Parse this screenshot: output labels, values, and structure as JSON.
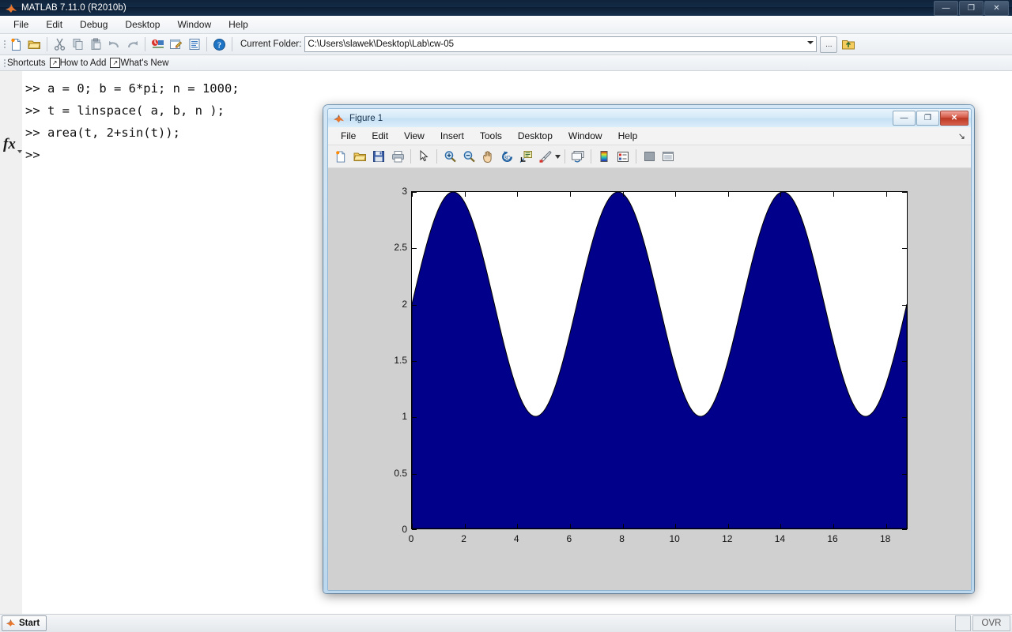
{
  "app": {
    "title": "MATLAB  7.11.0 (R2010b)",
    "icon": "matlab-logo-icon",
    "window_buttons": [
      {
        "name": "minimize",
        "glyph": "—"
      },
      {
        "name": "restore",
        "glyph": "❐"
      },
      {
        "name": "close",
        "glyph": "✕"
      }
    ]
  },
  "menubar": {
    "items": [
      "File",
      "Edit",
      "Debug",
      "Desktop",
      "Window",
      "Help"
    ]
  },
  "toolbar": {
    "icons": [
      "new-file-icon",
      "open-folder-icon",
      "cut-icon",
      "copy-icon",
      "paste-icon",
      "undo-icon",
      "redo-icon",
      "simulink-icon",
      "guide-icon",
      "profiler-icon",
      "help-icon"
    ],
    "current_folder_label": "Current Folder:",
    "current_folder_value": "C:\\Users\\slawek\\Desktop\\Lab\\cw-05",
    "browse_button_label": "...",
    "up_folder_icon": "up-folder-icon"
  },
  "shortcuts_bar": {
    "items": [
      "Shortcuts",
      "How to Add",
      "What's New"
    ],
    "icon": "shortcut-arrow-icon"
  },
  "command_window": {
    "prompt_icon": "fx-icon",
    "lines": [
      ">> a = 0; b = 6*pi; n = 1000;",
      ">> t = linspace( a, b, n );",
      ">> area(t, 2+sin(t));",
      ">> "
    ]
  },
  "statusbar": {
    "start_label": "Start",
    "start_icon": "matlab-logo-icon",
    "overwrite_label": "OVR"
  },
  "figure": {
    "title": "Figure 1",
    "icon": "matlab-logo-icon",
    "window_buttons": [
      {
        "name": "minimize",
        "glyph": "—"
      },
      {
        "name": "maximize",
        "glyph": "❐"
      },
      {
        "name": "close",
        "glyph": "✕"
      }
    ],
    "menubar": [
      "File",
      "Edit",
      "View",
      "Insert",
      "Tools",
      "Desktop",
      "Window",
      "Help"
    ],
    "menu_overflow_icon": "overflow-arrow-icon",
    "toolbar_icons": [
      "new-figure-icon",
      "open-file-icon",
      "save-figure-icon",
      "print-figure-icon",
      "pointer-icon",
      "zoom-in-icon",
      "zoom-out-icon",
      "pan-icon",
      "rotate-3d-icon",
      "data-cursor-icon",
      "brush-icon",
      "brush-dropdown-icon",
      "link-plot-icon",
      "colorbar-icon",
      "legend-icon",
      "hide-plot-tools-icon",
      "show-plot-tools-icon"
    ]
  },
  "chart_data": {
    "type": "area",
    "title": "",
    "xlabel": "",
    "ylabel": "",
    "expression": "area(t, 2+sin(t))",
    "xlim": [
      0,
      18.8495559
    ],
    "ylim": [
      0,
      3
    ],
    "xticks": [
      0,
      2,
      4,
      6,
      8,
      10,
      12,
      14,
      16,
      18
    ],
    "yticks": [
      0,
      0.5,
      1,
      1.5,
      2,
      2.5,
      3
    ],
    "xtick_labels": [
      "0",
      "2",
      "4",
      "6",
      "8",
      "10",
      "12",
      "14",
      "16",
      "18"
    ],
    "ytick_labels": [
      "0",
      "0.5",
      "1",
      "1.5",
      "2",
      "2.5",
      "3"
    ],
    "grid": false,
    "legend": null,
    "n_points": 1000,
    "fill_color": "#00008B",
    "edge_color": "#000000",
    "background_color": "#FFFFFF",
    "series": [
      {
        "name": "2+sin(t)",
        "baseline": 0,
        "formula": "2 + sin(x)",
        "key_points": [
          {
            "x": 0,
            "y": 2
          },
          {
            "x": 1.5708,
            "y": 3
          },
          {
            "x": 4.7124,
            "y": 1
          },
          {
            "x": 7.854,
            "y": 3
          },
          {
            "x": 10.9956,
            "y": 1
          },
          {
            "x": 14.1372,
            "y": 3
          },
          {
            "x": 17.2788,
            "y": 1
          },
          {
            "x": 18.8496,
            "y": 2
          }
        ]
      }
    ]
  }
}
